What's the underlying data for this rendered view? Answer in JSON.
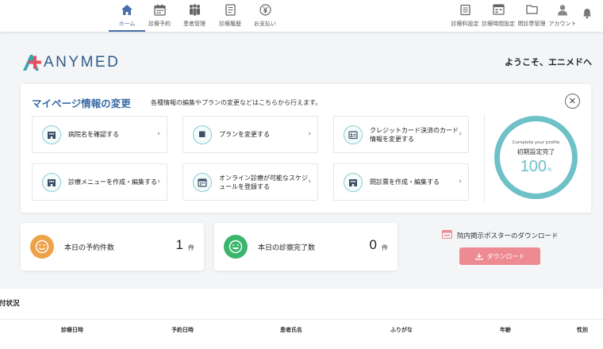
{
  "nav": {
    "left": [
      {
        "label": "ホーム",
        "icon": "home-icon"
      },
      {
        "label": "診療予約",
        "icon": "calendar-icon"
      },
      {
        "label": "患者管理",
        "icon": "users-icon"
      },
      {
        "label": "診療履歴",
        "icon": "document-icon"
      },
      {
        "label": "お支払い",
        "icon": "yen-icon"
      }
    ],
    "right": [
      {
        "label": "診療料設定",
        "icon": "fee-setting-icon"
      },
      {
        "label": "診療時間設定",
        "icon": "schedule-setting-icon"
      },
      {
        "label": "問診票管理",
        "icon": "folder-icon"
      },
      {
        "label": "アカウント",
        "icon": "person-icon"
      }
    ],
    "bell_icon": "bell-icon"
  },
  "brand": {
    "name": "ANYMED",
    "logo_colors": [
      "#e84f5e",
      "#3aa5b0",
      "#2f5d8a"
    ]
  },
  "greeting": "ようこそ、エニメドへ",
  "profile_card": {
    "title": "マイページ情報の変更",
    "subtitle": "各種情報の編集やプランの変更などはこちらから行えます。",
    "tiles": [
      {
        "label": "病院名を確認する"
      },
      {
        "label": "プランを変更する"
      },
      {
        "label": "クレジットカード決済のカード情報を変更する"
      },
      {
        "label": "診療メニューを作成・編集する"
      },
      {
        "label": "オンライン診療が可能なスケジュールを登録する"
      },
      {
        "label": "問診票を作成・編集する"
      }
    ],
    "progress": {
      "caption": "Complete your profile",
      "status": "初期設定完了",
      "value": "100",
      "unit": "%"
    }
  },
  "stats": [
    {
      "label": "本日の予約件数",
      "value": "1",
      "unit": "件",
      "color": "#eea24a"
    },
    {
      "label": "本日の診察完了数",
      "value": "0",
      "unit": "件",
      "color": "#3bb56c"
    }
  ],
  "poster": {
    "label": "院内掲示ポスターのダウンロード",
    "button": "ダウンロード",
    "accent": "#ed8a92"
  },
  "reservations": {
    "title": "付状況",
    "columns": [
      "診療日時",
      "予約日時",
      "患者氏名",
      "ふりがな",
      "年齢",
      "性別"
    ]
  },
  "colors": {
    "primary": "#3b6aa6",
    "teal": "#6fc1c8"
  }
}
